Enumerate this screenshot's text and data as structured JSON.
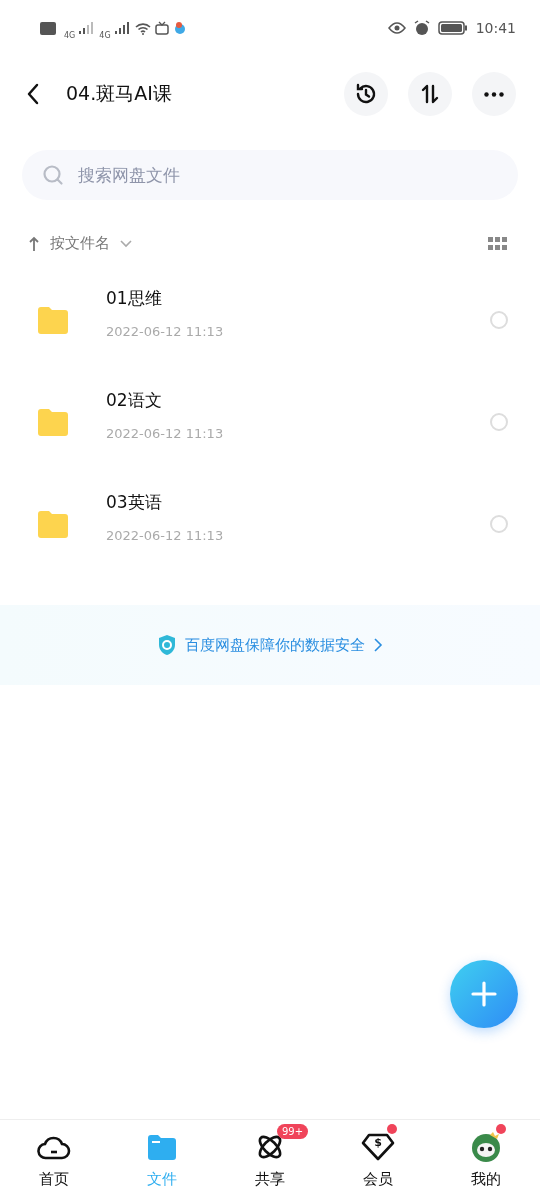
{
  "status_bar": {
    "time": "10:41",
    "network_1": "4G",
    "network_2": "4G"
  },
  "header": {
    "title": "04.斑马AI课"
  },
  "search": {
    "placeholder": "搜索网盘文件"
  },
  "sort": {
    "label": "按文件名"
  },
  "files": [
    {
      "name": "01思维",
      "date": "2022-06-12 11:13",
      "selected": false
    },
    {
      "name": "02语文",
      "date": "2022-06-12 11:13",
      "selected": false
    },
    {
      "name": "03英语",
      "date": "2022-06-12 11:13",
      "selected": false
    }
  ],
  "banner": {
    "text": "百度网盘保障你的数据安全"
  },
  "tabs": [
    {
      "label": "首页",
      "kind": "cloud",
      "selected": false
    },
    {
      "label": "文件",
      "kind": "folder",
      "selected": true
    },
    {
      "label": "共享",
      "kind": "atom",
      "selected": false,
      "badge": "99+"
    },
    {
      "label": "会员",
      "kind": "diamond",
      "selected": false,
      "dot": true,
      "glyph": "$"
    },
    {
      "label": "我的",
      "kind": "avatar",
      "selected": false,
      "dot": true
    }
  ]
}
